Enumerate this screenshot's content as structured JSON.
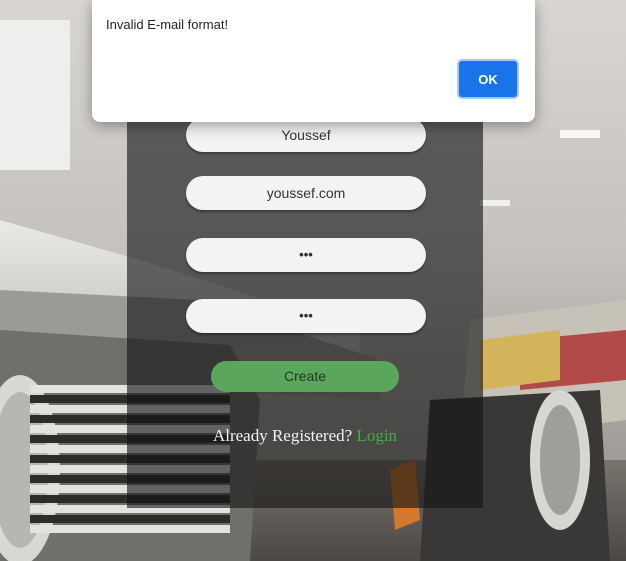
{
  "alert": {
    "message": "Invalid E-mail format!",
    "ok_label": "OK"
  },
  "form": {
    "name_value": "Youssef",
    "email_value": "youssef.com",
    "password_value": "•••",
    "confirm_password_value": "•••",
    "create_label": "Create",
    "already_registered_text": "Already Registered?",
    "login_link_text": "Login"
  },
  "colors": {
    "accent_green": "#5aa65d",
    "link_green": "#3cb043",
    "dialog_button_blue": "#1a73e8"
  }
}
